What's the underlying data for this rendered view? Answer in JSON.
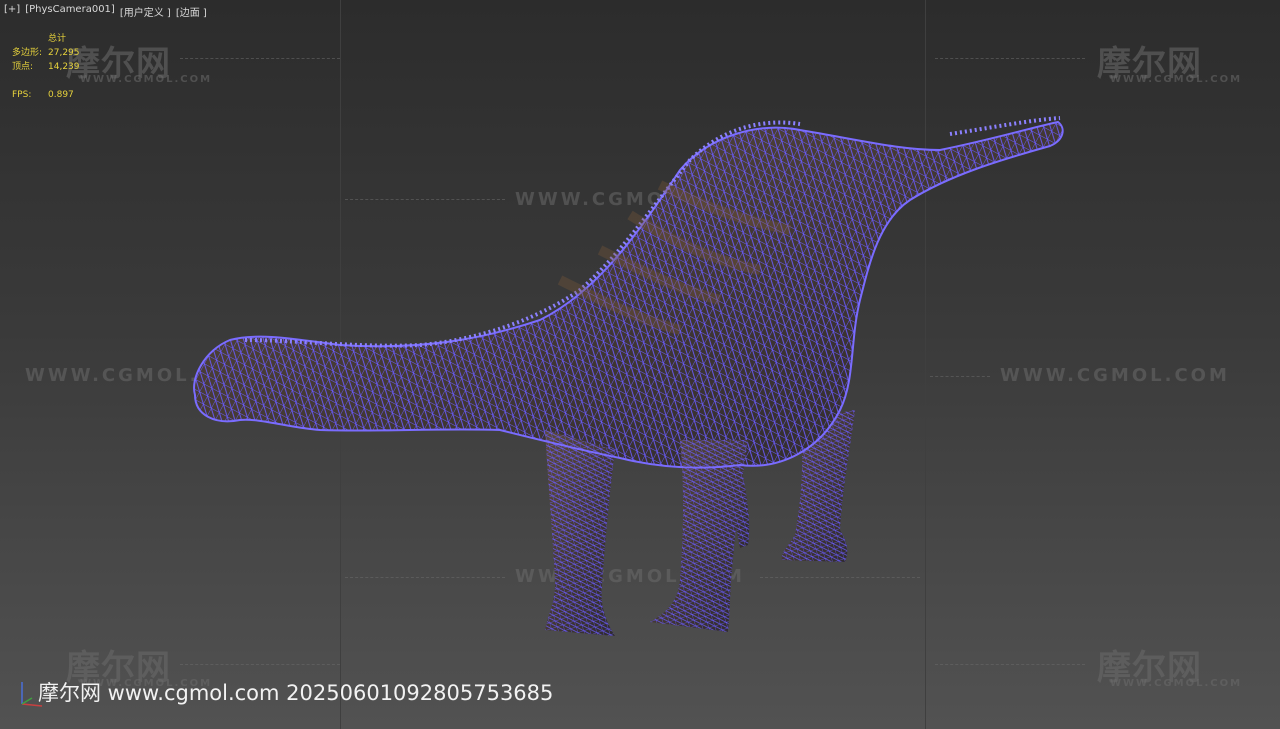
{
  "viewport": {
    "menu_plus": "[+]",
    "camera": "[PhysCamera001]",
    "shading_mode": "[用户定义 ]",
    "render_mode": "[边面 ]"
  },
  "stats": {
    "header": "总计",
    "polygons_label": "多边形:",
    "polygons_value": "27,295",
    "vertices_label": "顶点:",
    "vertices_value": "14,239",
    "fps_label": "FPS:",
    "fps_value": "0.897"
  },
  "watermarks": {
    "brand_cn": "摩尔网",
    "brand_en": "WWW.CGMOL.COM",
    "url_large": "WWW.CGMOL.COM"
  },
  "footer": {
    "caption": "摩尔网 www.cgmol.com 20250601092805753685"
  },
  "colors": {
    "wireframe": "#6a5cff",
    "stats_text": "#e6d23c",
    "background_top": "#2c2c2c",
    "background_bottom": "#525252"
  }
}
